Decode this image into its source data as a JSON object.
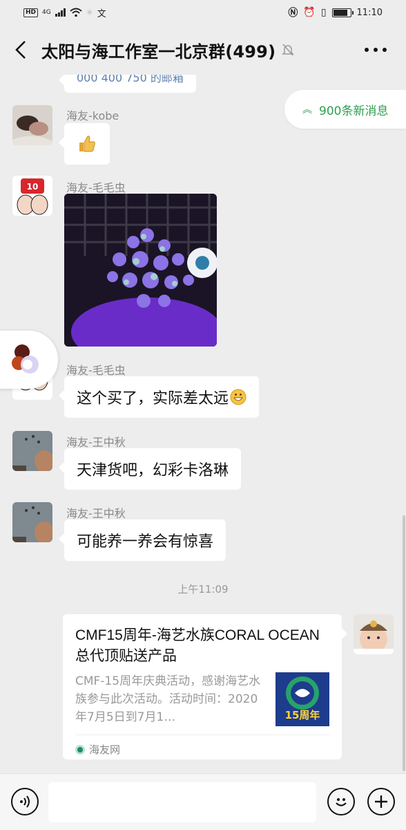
{
  "status_bar": {
    "hd": "HD",
    "net": "4G",
    "time": "11:10",
    "battery_level": 0.85
  },
  "header": {
    "title": "太阳与海工作室一北京群(499)",
    "icons": [
      "back-arrow-icon",
      "mute-bell-icon",
      "more-icon"
    ]
  },
  "partial_top_text": "000 400 750 的邮箱",
  "new_messages": {
    "label": "900条新消息"
  },
  "messages": [
    {
      "sender": "海友-kobe",
      "type": "emoji",
      "content": "thumbs-up"
    },
    {
      "sender": "海友-毛毛虫",
      "type": "image",
      "content": "coral photo"
    },
    {
      "sender": "海友-毛毛虫",
      "type": "text",
      "content": "这个买了，实际差太远"
    },
    {
      "sender": "海友-王中秋",
      "type": "text",
      "content": "天津货吧，幻彩卡洛琳"
    },
    {
      "sender": "海友-王中秋",
      "type": "text",
      "content": "可能养一养会有惊喜"
    }
  ],
  "timestamp": "上午11:09",
  "link_card": {
    "title": "CMF15周年-海艺水族CORAL OCEAN总代顶贴送产品",
    "description": "CMF-15周年庆典活动，感谢海艺水族参与此次活动。活动时间：2020年7月5日到7月1…",
    "thumb_label": "15周年",
    "source": "海友网"
  },
  "input_bar": {
    "icons": [
      "voice-icon",
      "emoji-icon",
      "plus-icon"
    ]
  },
  "colors": {
    "background": "#ededed",
    "bubble": "#ffffff",
    "accent_green": "#2e9e4f",
    "muted_text": "#888888"
  }
}
